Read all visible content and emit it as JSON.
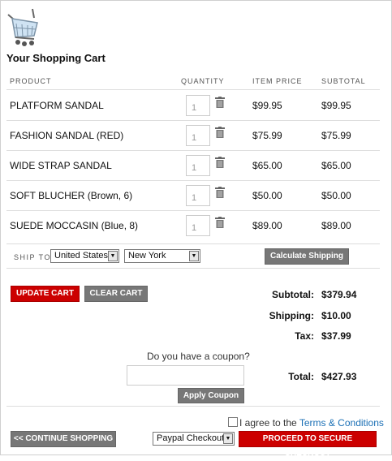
{
  "header": {
    "title": "Your Shopping Cart",
    "cart_icon": "shopping-cart-icon"
  },
  "columns": {
    "product": "PRODUCT",
    "quantity": "QUANTITY",
    "item_price": "ITEM PRICE",
    "subtotal": "SUBTOTAL"
  },
  "items": [
    {
      "name": "PLATFORM SANDAL",
      "qty": "1",
      "price": "$99.95",
      "subtotal": "$99.95"
    },
    {
      "name": "FASHION SANDAL (RED)",
      "qty": "1",
      "price": "$75.99",
      "subtotal": "$75.99"
    },
    {
      "name": "WIDE STRAP SANDAL",
      "qty": "1",
      "price": "$65.00",
      "subtotal": "$65.00"
    },
    {
      "name": "SOFT BLUCHER (Brown, 6)",
      "qty": "1",
      "price": "$50.00",
      "subtotal": "$50.00"
    },
    {
      "name": "SUEDE MOCCASIN (Blue, 8)",
      "qty": "1",
      "price": "$89.00",
      "subtotal": "$89.00"
    }
  ],
  "shipping": {
    "label": "SHIP TO:",
    "country": "United States",
    "state": "New York",
    "calculate_label": "Calculate Shipping"
  },
  "actions": {
    "update_cart": "UPDATE CART",
    "clear_cart": "CLEAR CART",
    "continue_shopping": "<< CONTINUE SHOPPING",
    "checkout_method": "Paypal Checkout",
    "proceed": "PROCEED TO SECURE CHECKOUT"
  },
  "totals": {
    "subtotal_label": "Subtotal:",
    "subtotal": "$379.94",
    "shipping_label": "Shipping:",
    "shipping": "$10.00",
    "tax_label": "Tax:",
    "tax": "$37.99",
    "total_label": "Total:",
    "total": "$427.93"
  },
  "coupon": {
    "question": "Do you have a coupon?",
    "apply_label": "Apply Coupon",
    "value": ""
  },
  "terms": {
    "agree_text": "I agree to the ",
    "link_text": "Terms & Conditions",
    "checked": false
  },
  "colors": {
    "primary_red": "#cc0000",
    "button_gray": "#777777",
    "link_blue": "#1a6fb5"
  }
}
